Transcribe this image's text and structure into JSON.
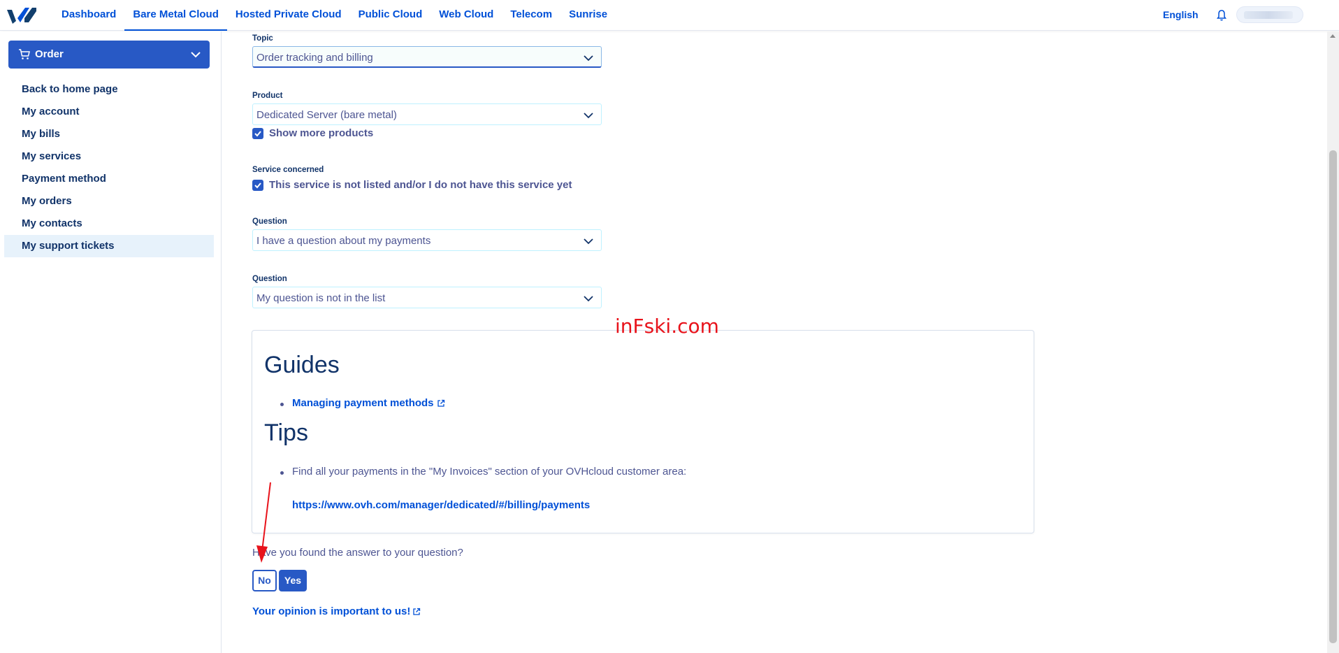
{
  "nav": {
    "items": [
      {
        "label": "Dashboard",
        "active": false
      },
      {
        "label": "Bare Metal Cloud",
        "active": true
      },
      {
        "label": "Hosted Private Cloud",
        "active": false
      },
      {
        "label": "Public Cloud",
        "active": false
      },
      {
        "label": "Web Cloud",
        "active": false
      },
      {
        "label": "Telecom",
        "active": false
      },
      {
        "label": "Sunrise",
        "active": false
      }
    ],
    "language": "English"
  },
  "sidebar": {
    "order_label": "Order",
    "items": [
      {
        "label": "Back to home page"
      },
      {
        "label": "My account"
      },
      {
        "label": "My bills"
      },
      {
        "label": "My services"
      },
      {
        "label": "Payment method"
      },
      {
        "label": "My orders"
      },
      {
        "label": "My contacts"
      },
      {
        "label": "My support tickets",
        "active": true
      }
    ]
  },
  "form": {
    "topic": {
      "label": "Topic",
      "value": "Order tracking and billing"
    },
    "product": {
      "label": "Product",
      "value": "Dedicated Server (bare metal)",
      "show_more_label": "Show more products",
      "show_more_checked": true
    },
    "service": {
      "label": "Service concerned",
      "not_listed_label": "This service is not listed and/or I do not have this service yet",
      "not_listed_checked": true
    },
    "question1": {
      "label": "Question",
      "value": "I have a question about my payments"
    },
    "question2": {
      "label": "Question",
      "value": "My question is not in the list"
    }
  },
  "card": {
    "guides_title": "Guides",
    "guide_link": "Managing payment methods",
    "tips_title": "Tips",
    "tip_text": "Find all your payments in the \"My Invoices\" section of your OVHcloud customer area:",
    "tip_url": "https://www.ovh.com/manager/dedicated/#/billing/payments"
  },
  "feedback": {
    "question": "Have you found the answer to your question?",
    "no_label": "No",
    "yes_label": "Yes",
    "opinion_link": "Your opinion is important to us!"
  },
  "watermark": "inFski.com",
  "colors": {
    "brand_blue": "#2859c5",
    "link_blue": "#0050d7",
    "active_bg": "#e7f2fb",
    "watermark_red": "#e8131b"
  }
}
